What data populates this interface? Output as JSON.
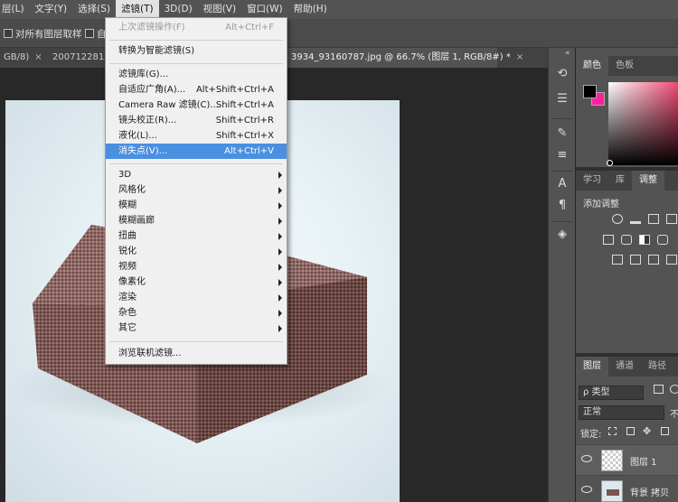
{
  "menubar": {
    "items": [
      "层(L)",
      "文字(Y)",
      "选择(S)",
      "滤镜(T)",
      "3D(D)",
      "视图(V)",
      "窗口(W)",
      "帮助(H)"
    ]
  },
  "options": {
    "sample_all_layers": "对所有图层取样",
    "auto_fragment": "自"
  },
  "tabs": {
    "tab1": "GB/8)",
    "tab2": "200712281",
    "tab3": "3934_93160787.jpg @ 66.7% (图层 1, RGB/8#) *",
    "close": "×"
  },
  "filter_menu": {
    "last_filter": {
      "label": "上次滤镜操作(F)",
      "shortcut": "Alt+Ctrl+F"
    },
    "convert_smart": "转换为智能滤镜(S)",
    "gallery": "滤镜库(G)...",
    "adaptive_wide": {
      "label": "自适应广角(A)...",
      "shortcut": "Alt+Shift+Ctrl+A"
    },
    "camera_raw": {
      "label": "Camera Raw 滤镜(C)...",
      "shortcut": "Shift+Ctrl+A"
    },
    "lens_correction": {
      "label": "镜头校正(R)...",
      "shortcut": "Shift+Ctrl+R"
    },
    "liquify": {
      "label": "液化(L)...",
      "shortcut": "Shift+Ctrl+X"
    },
    "vanishing_point": {
      "label": "消失点(V)...",
      "shortcut": "Alt+Ctrl+V"
    },
    "submenus": [
      "3D",
      "风格化",
      "模糊",
      "模糊画廊",
      "扭曲",
      "锐化",
      "视频",
      "像素化",
      "渲染",
      "杂色",
      "其它"
    ],
    "browse_online": "浏览联机滤镜..."
  },
  "color_panel": {
    "tabs": [
      "颜色",
      "色板"
    ],
    "foreground": "#000000",
    "background": "#ff1fa0"
  },
  "adjust_panel": {
    "tabs": [
      "学习",
      "库",
      "调整"
    ],
    "add_adjustment": "添加调整"
  },
  "layers_panel": {
    "tabs": [
      "图层",
      "通道",
      "路径"
    ],
    "filter_kind": "ρ 类型",
    "blend_mode": "正常",
    "opacity_label": "不",
    "lock_label": "锁定:",
    "layers": [
      {
        "name": "图层 1",
        "thumb": "transparent"
      },
      {
        "name": "背景 拷贝",
        "thumb": "box"
      }
    ]
  },
  "colors": {
    "menu_highlight": "#4a8fe0",
    "box_fabric": "#7a5550"
  }
}
